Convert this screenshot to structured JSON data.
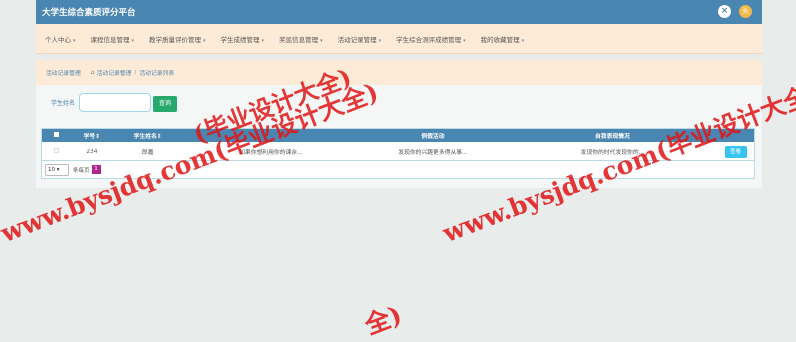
{
  "app": {
    "title": "大学生综合素质评分平台"
  },
  "topbar": {
    "close_icon": "×",
    "avatar_icon": "头"
  },
  "menu": [
    {
      "label": "个人中心"
    },
    {
      "label": "课程信息管理"
    },
    {
      "label": "教学质量评价管理"
    },
    {
      "label": "学生成绩管理"
    },
    {
      "label": "奖惩信息管理"
    },
    {
      "label": "活动记录管理"
    },
    {
      "label": "学生综合测评成绩管理"
    },
    {
      "label": "我的收藏管理"
    }
  ],
  "breadcrumb": {
    "section": "活动记录管理",
    "path1": "活动记录管理",
    "path2": "活动记录列表"
  },
  "search": {
    "label": "学生姓名",
    "placeholder": "",
    "button_label": "查询"
  },
  "table": {
    "headers": [
      "学号",
      "学生姓名",
      "",
      "例假活动",
      "自我表现情况",
      ""
    ],
    "rows": [
      {
        "id": "234",
        "name": "郎嘉",
        "col_a": "如果你想利用你的课余...",
        "col_b": "发现你的兴趣更多得从事...",
        "col_c": "发现你的时代发现你的...",
        "action": "查看"
      }
    ]
  },
  "pagination": {
    "page_size": "10",
    "total_label": "条每页",
    "current_page": "1"
  },
  "watermarks": {
    "w1": "www.bysjdq.com(毕业设计大全)",
    "w2": "www.bysjdq.com(毕业设计大全)",
    "w3": "(毕业设计大全)",
    "w4": "全)"
  },
  "colors": {
    "topbar": "#4a86b2",
    "menubar": "#fdebd8",
    "search_button": "#27a96e",
    "view_button": "#36c5f0",
    "pager_current": "#b0268c",
    "watermark": "#e11414"
  }
}
